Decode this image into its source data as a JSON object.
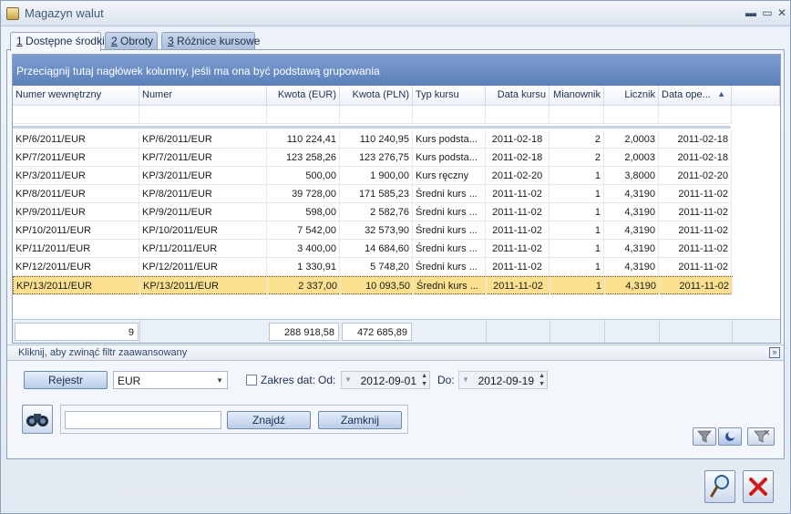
{
  "window": {
    "title": "Magazyn walut"
  },
  "tabs": [
    {
      "key": "1",
      "label": "Dostępne środki",
      "active": true
    },
    {
      "key": "2",
      "label": "Obroty",
      "active": false
    },
    {
      "key": "3",
      "label": "Różnice kursowe",
      "active": false
    }
  ],
  "grid": {
    "group_hint": "Przeciągnij tutaj nagłówek kolumny, jeśli ma ona być podstawą grupowania",
    "columns": [
      "Numer wewnętrzny",
      "Numer",
      "Kwota (EUR)",
      "Kwota (PLN)",
      "Typ kursu",
      "Data kursu",
      "Mianownik",
      "Licznik",
      "Data ope..."
    ],
    "sort_indicator": "▲",
    "rows": [
      [
        "KP/6/2011/EUR",
        "KP/6/2011/EUR",
        "110 224,41",
        "110 240,95",
        "Kurs podsta...",
        "2011-02-18",
        "2",
        "2,0003",
        "2011-02-18"
      ],
      [
        "KP/7/2011/EUR",
        "KP/7/2011/EUR",
        "123 258,26",
        "123 276,75",
        "Kurs podsta...",
        "2011-02-18",
        "2",
        "2,0003",
        "2011-02-18"
      ],
      [
        "KP/3/2011/EUR",
        "KP/3/2011/EUR",
        "500,00",
        "1 900,00",
        "Kurs ręczny",
        "2011-02-20",
        "1",
        "3,8000",
        "2011-02-20"
      ],
      [
        "KP/8/2011/EUR",
        "KP/8/2011/EUR",
        "39 728,00",
        "171 585,23",
        "Średni kurs ...",
        "2011-11-02",
        "1",
        "4,3190",
        "2011-11-02"
      ],
      [
        "KP/9/2011/EUR",
        "KP/9/2011/EUR",
        "598,00",
        "2 582,76",
        "Średni kurs ...",
        "2011-11-02",
        "1",
        "4,3190",
        "2011-11-02"
      ],
      [
        "KP/10/2011/EUR",
        "KP/10/2011/EUR",
        "7 542,00",
        "32 573,90",
        "Średni kurs ...",
        "2011-11-02",
        "1",
        "4,3190",
        "2011-11-02"
      ],
      [
        "KP/11/2011/EUR",
        "KP/11/2011/EUR",
        "3 400,00",
        "14 684,60",
        "Średni kurs ...",
        "2011-11-02",
        "1",
        "4,3190",
        "2011-11-02"
      ],
      [
        "KP/12/2011/EUR",
        "KP/12/2011/EUR",
        "1 330,91",
        "5 748,20",
        "Średni kurs ...",
        "2011-11-02",
        "1",
        "4,3190",
        "2011-11-02"
      ],
      [
        "KP/13/2011/EUR",
        "KP/13/2011/EUR",
        "2 337,00",
        "10 093,50",
        "Średni kurs ...",
        "2011-11-02",
        "1",
        "4,3190",
        "2011-11-02"
      ]
    ],
    "selected_row": 8,
    "footer": {
      "count": "9",
      "sum_eur": "288 918,58",
      "sum_pln": "472 685,89"
    }
  },
  "advanced_filter": {
    "toggle_label": "Kliknij, aby zwinąć filtr zaawansowany",
    "register_button": "Rejestr",
    "currency_value": "EUR",
    "date_range_label": "Zakres dat:",
    "from_label": "Od:",
    "from_value": "2012-09-01",
    "to_label": "Do:",
    "to_value": "2012-09-19",
    "search_value": "",
    "find_button": "Znajdź",
    "close_button": "Zamknij"
  }
}
